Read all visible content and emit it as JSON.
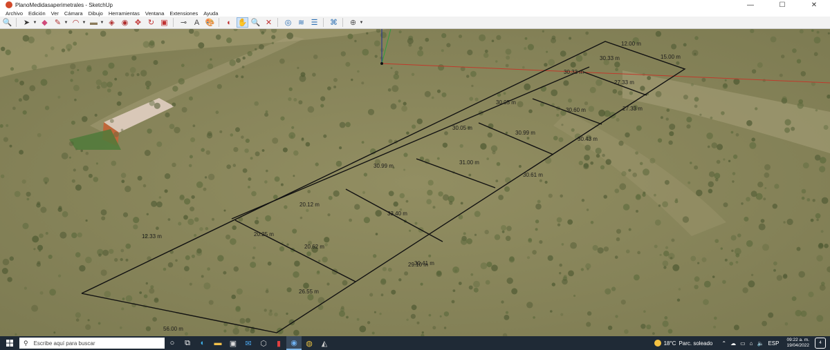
{
  "window": {
    "title": "PlanoMedidasaperimetrales - SketchUp",
    "minimize": "—",
    "maximize": "☐",
    "close": "✕"
  },
  "menu": [
    "Archivo",
    "Edición",
    "Ver",
    "Cámara",
    "Dibujo",
    "Herramientas",
    "Ventana",
    "Extensiones",
    "Ayuda"
  ],
  "toolbar": {
    "tools": [
      "search-icon",
      "select-arrow-icon",
      "eraser-icon",
      "pencil-icon",
      "arc-icon",
      "rectangle-icon",
      "pushpull-icon",
      "followme-icon",
      "move-icon",
      "rotate-icon",
      "scale-icon",
      "tape-measure-icon",
      "text-icon",
      "paint-icon",
      "orbit-icon",
      "pan-icon",
      "zoom-icon",
      "zoom-extents-icon",
      "geo-location-icon",
      "terrain-icon",
      "layers-icon",
      "sandbox-icon",
      "extension-warehouse-icon"
    ],
    "selected": "pan-icon"
  },
  "viewport": {
    "dimensions": [
      "12.00 m",
      "15.00 m",
      "30.33 m",
      "30.33 m",
      "27.33 m",
      "27.33 m",
      "30.05 m",
      "30.05 m",
      "30.99 m",
      "30.43 m",
      "30.61 m",
      "31.00 m",
      "30.99 m",
      "33.40 m",
      "30.41 m",
      "20.12 m",
      "20.25 m",
      "20.62 m",
      "29.10 m",
      "26.55 m",
      "56.00 m",
      "12.33 m",
      "30.60 m"
    ],
    "colors": {
      "terrain": "#8c8a5e",
      "edges": "#111111",
      "axis_red": "#c0392b",
      "axis_green": "#2e9e3e",
      "axis_blue": "#2b3a8c"
    }
  },
  "taskbar": {
    "search_placeholder": "Escribe aquí para buscar",
    "weather_temp": "18°C",
    "weather_desc": "Parc. soleado",
    "language": "ESP",
    "time": "09:22 a. m.",
    "date": "19/04/2022",
    "notifications": "4"
  }
}
